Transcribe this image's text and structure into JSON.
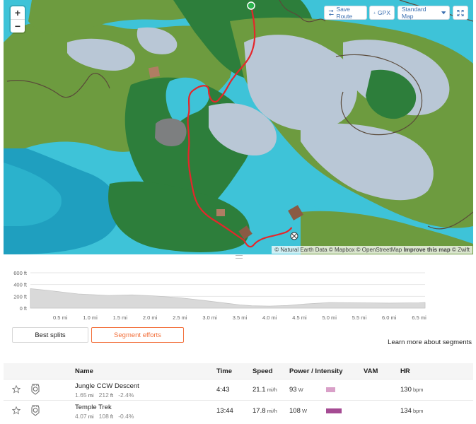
{
  "map": {
    "zoom_in_label": "+",
    "zoom_out_label": "−",
    "save_route_label": "Save Route",
    "gpx_label": "GPX",
    "map_style_label": "Standard Map",
    "attribution": {
      "prefix": "© Natural Earth Data © Mapbox © OpenStreetMap",
      "improve": "Improve this map",
      "suffix": "© Zwift"
    },
    "colors": {
      "water": "#3ec3d8",
      "deep_water": "#1f9fbf",
      "jungle": "#2d7e3b",
      "grass": "#6d9b3f",
      "snow": "#b9c7d6",
      "route": "#e5262b",
      "start_marker": "#2bb24c"
    }
  },
  "elevation": {
    "y_ticks": [
      "600 ft",
      "400 ft",
      "200 ft",
      "0 ft"
    ],
    "x_ticks": [
      "0.5 mi",
      "1.0 mi",
      "1.5 mi",
      "2.0 mi",
      "2.5 mi",
      "3.0 mi",
      "3.5 mi",
      "4.0 mi",
      "4.5 mi",
      "5.0 mi",
      "5.5 mi",
      "6.0 mi",
      "6.5 mi"
    ],
    "profile": [
      [
        0,
        330
      ],
      [
        0.3,
        300
      ],
      [
        0.8,
        240
      ],
      [
        1.3,
        215
      ],
      [
        1.7,
        225
      ],
      [
        2.1,
        205
      ],
      [
        2.5,
        175
      ],
      [
        2.9,
        130
      ],
      [
        3.3,
        80
      ],
      [
        3.5,
        55
      ],
      [
        3.7,
        40
      ],
      [
        4.0,
        35
      ],
      [
        4.3,
        45
      ],
      [
        4.6,
        70
      ],
      [
        5.0,
        95
      ],
      [
        5.5,
        90
      ],
      [
        6.0,
        85
      ],
      [
        6.5,
        90
      ],
      [
        6.6,
        95
      ]
    ]
  },
  "tabs": {
    "best_splits": "Best splits",
    "segment_efforts": "Segment efforts"
  },
  "learn_more": "Learn more about segments",
  "table": {
    "headers": {
      "name": "Name",
      "time": "Time",
      "speed": "Speed",
      "power": "Power / Intensity",
      "vam": "VAM",
      "hr": "HR"
    },
    "rows": [
      {
        "name": "Jungle CCW Descent",
        "distance": "1.65",
        "distance_unit": "mi",
        "elevation": "212",
        "elevation_unit": "ft",
        "grade": "-2.4%",
        "time": "4:43",
        "speed": "21.1",
        "speed_unit": "mi/h",
        "power": "93",
        "power_unit": "W",
        "intensity": 0.44,
        "intensity_color": "#d9a0c8",
        "hr": "130",
        "hr_unit": "bpm"
      },
      {
        "name": "Temple Trek",
        "distance": "4.07",
        "distance_unit": "mi",
        "elevation": "108",
        "elevation_unit": "ft",
        "grade": "-0.4%",
        "time": "13:44",
        "speed": "17.8",
        "speed_unit": "mi/h",
        "power": "108",
        "power_unit": "W",
        "intensity": 0.72,
        "intensity_color": "#a54b93",
        "hr": "134",
        "hr_unit": "bpm"
      }
    ]
  }
}
